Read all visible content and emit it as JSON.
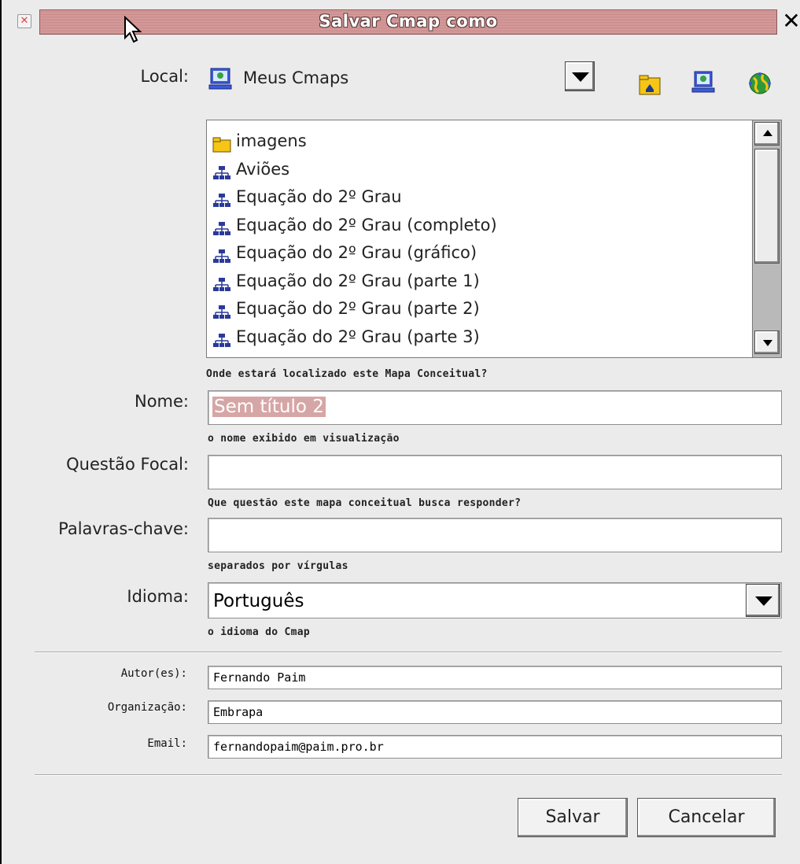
{
  "window": {
    "title": "Salvar Cmap como"
  },
  "local": {
    "label": "Local:",
    "value": "Meus Cmaps"
  },
  "list": {
    "items": [
      {
        "label": "imagens",
        "icon": "folder-icon"
      },
      {
        "label": "Aviões",
        "icon": "cmap-icon"
      },
      {
        "label": "Equação do 2º Grau",
        "icon": "cmap-icon"
      },
      {
        "label": "Equação do 2º Grau (completo)",
        "icon": "cmap-icon"
      },
      {
        "label": "Equação do 2º Grau (gráfico)",
        "icon": "cmap-icon"
      },
      {
        "label": "Equação do 2º Grau (parte 1)",
        "icon": "cmap-icon"
      },
      {
        "label": "Equação do 2º Grau (parte 2)",
        "icon": "cmap-icon"
      },
      {
        "label": "Equação do 2º Grau (parte 3)",
        "icon": "cmap-icon"
      }
    ],
    "hint": "Onde estará localizado este Mapa Conceitual?"
  },
  "nome": {
    "label": "Nome:",
    "value": "Sem título 2",
    "hint": "o nome exibido em visualização"
  },
  "questao": {
    "label": "Questão Focal:",
    "value": "",
    "hint": "Que questão este mapa conceitual busca responder?"
  },
  "palavras": {
    "label": "Palavras-chave:",
    "value": "",
    "hint": "separados por vírgulas"
  },
  "idioma": {
    "label": "Idioma:",
    "value": "Português",
    "hint": "o idioma do Cmap"
  },
  "autor": {
    "label": "Autor(es):",
    "value": "Fernando Paim"
  },
  "organizacao": {
    "label": "Organização:",
    "value": "Embrapa"
  },
  "email": {
    "label": "Email:",
    "value": "fernandopaim@paim.pro.br"
  },
  "buttons": {
    "save": "Salvar",
    "cancel": "Cancelar"
  }
}
